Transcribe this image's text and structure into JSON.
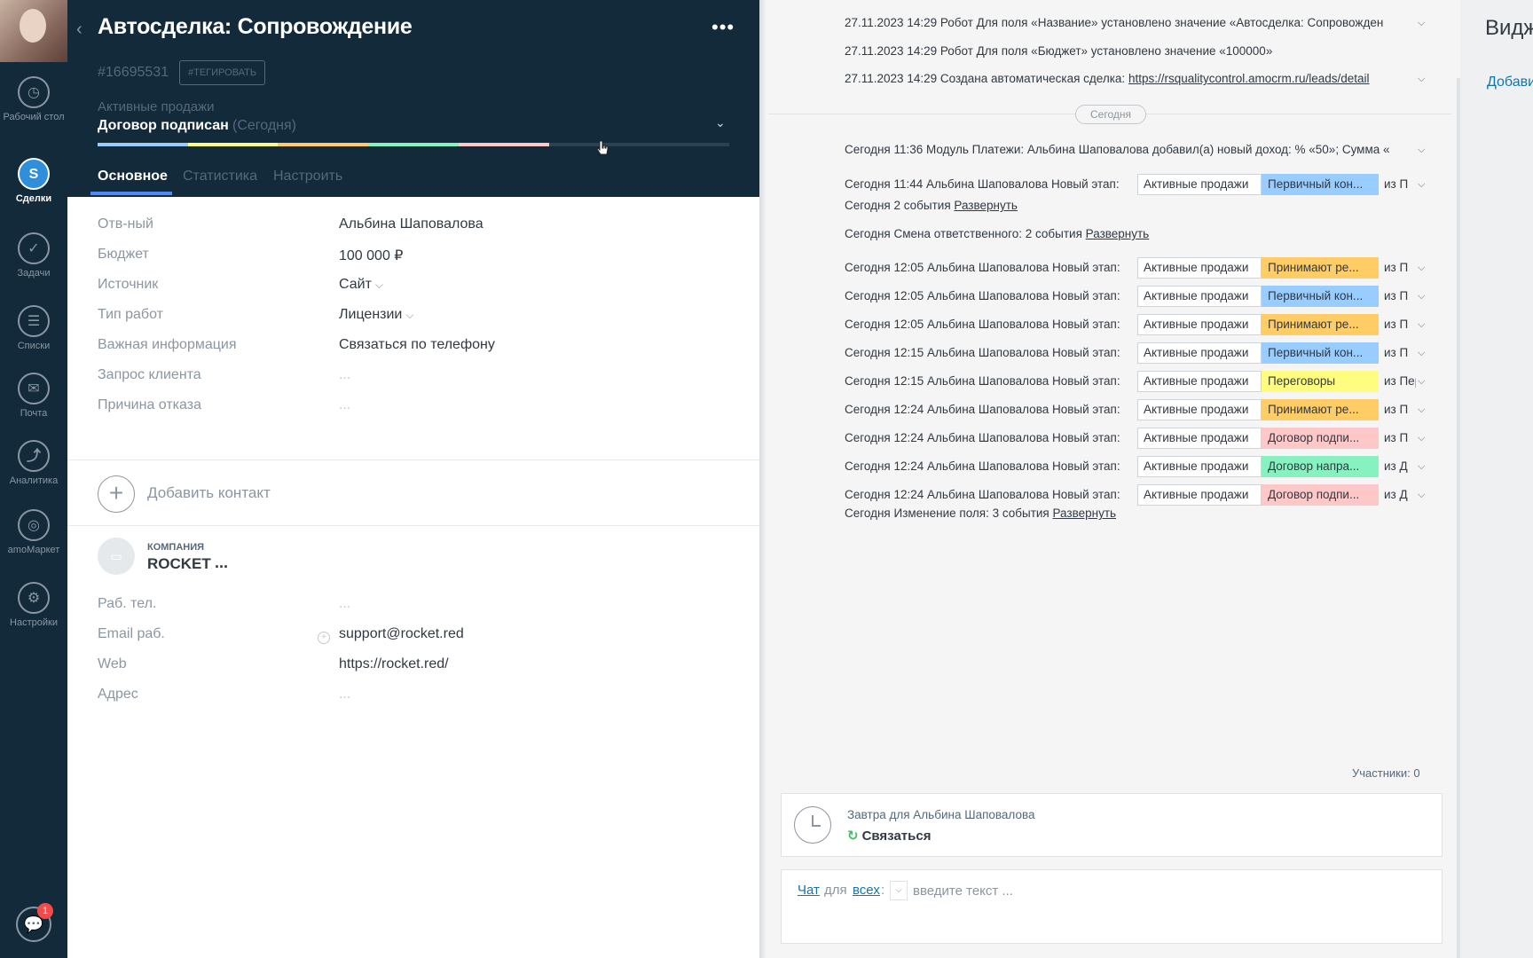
{
  "nav": {
    "items": [
      {
        "label": "Рабочий стол",
        "icon": "dashboard-icon"
      },
      {
        "label": "Сделки",
        "icon": "deals-icon"
      },
      {
        "label": "Задачи",
        "icon": "tasks-icon"
      },
      {
        "label": "Списки",
        "icon": "lists-icon"
      },
      {
        "label": "Почта",
        "icon": "mail-icon"
      },
      {
        "label": "Аналитика",
        "icon": "analytics-icon"
      },
      {
        "label": "amoМаркет",
        "icon": "market-icon"
      },
      {
        "label": "Настройки",
        "icon": "settings-icon"
      }
    ],
    "chat_badge": "1"
  },
  "card": {
    "title": "Автосделка: Сопровождение",
    "id": "#16695531",
    "tag_button": "#ТЕГИРОВАТЬ",
    "pipeline": "Активные продажи",
    "stage": "Договор подписан",
    "stage_when": "(Сегодня)",
    "progress_colors": [
      "#99ccfd",
      "#fffd7f",
      "#ffcc66",
      "#87f2c0",
      "#ffc8c8",
      "#2a4254",
      "#2a4254"
    ],
    "tabs": [
      "Основное",
      "Статистика",
      "Настроить"
    ],
    "fields": [
      {
        "label": "Отв-ный",
        "value": "Альбина Шаповалова"
      },
      {
        "label": "Бюджет",
        "value": "100 000 ₽"
      },
      {
        "label": "Источник",
        "value": "Сайт"
      },
      {
        "label": "Тип работ",
        "value": "Лицензии"
      },
      {
        "label": "Важная информация",
        "value": "Связаться по телефону"
      },
      {
        "label": "Запрос клиента",
        "value": "..."
      },
      {
        "label": "Причина отказа",
        "value": "..."
      }
    ],
    "add_contact": "Добавить контакт",
    "company": {
      "type_label": "КОМПАНИЯ",
      "name": "ROCKET",
      "more": "...",
      "fields": [
        {
          "label": "Раб. тел.",
          "value": "..."
        },
        {
          "label": "Email раб.",
          "value": "support@rocket.red"
        },
        {
          "label": "Web",
          "value": "https://rocket.red/"
        },
        {
          "label": "Адрес",
          "value": "..."
        }
      ]
    }
  },
  "feed": {
    "top_lines": [
      {
        "prefix": "27.11.2023 14:29 Робот Для поля «Название» установлено значение «Автосделка: Сопровожден",
        "link": ""
      },
      {
        "prefix": "27.11.2023 14:29 Робот Для поля «Бюджет» установлено значение «100000»",
        "link": ""
      },
      {
        "prefix": "27.11.2023 14:29 Создана автоматическая сделка: ",
        "link": "https://rsqualitycontrol.amocrm.ru/leads/detail"
      }
    ],
    "today_label": "Сегодня",
    "income_line": "Сегодня 11:36 Модуль Платежи: Альбина Шаповалова добавил(а) новый доход: % «50»; Сумма «",
    "stage_rows": [
      {
        "prefix": "Сегодня 11:44 Альбина Шаповалова Новый этап:",
        "old": "Активные продажи",
        "new": "Первичный кон...",
        "color": "#99ccff",
        "from": "из П"
      },
      {
        "prefix": "Сегодня 12:05 Альбина Шаповалова Новый этап:",
        "old": "Активные продажи",
        "new": "Принимают ре...",
        "color": "#ffcc66",
        "from": "из П"
      },
      {
        "prefix": "Сегодня 12:05 Альбина Шаповалова Новый этап:",
        "old": "Активные продажи",
        "new": "Первичный кон...",
        "color": "#99ccff",
        "from": "из П"
      },
      {
        "prefix": "Сегодня 12:05 Альбина Шаповалова Новый этап:",
        "old": "Активные продажи",
        "new": "Принимают ре...",
        "color": "#ffcc66",
        "from": "из П"
      },
      {
        "prefix": "Сегодня 12:15 Альбина Шаповалова Новый этап:",
        "old": "Активные продажи",
        "new": "Первичный кон...",
        "color": "#99ccff",
        "from": "из П"
      },
      {
        "prefix": "Сегодня 12:15 Альбина Шаповалова Новый этап:",
        "old": "Активные продажи",
        "new": "Переговоры",
        "color": "#fffd7f",
        "from": "из Первич"
      },
      {
        "prefix": "Сегодня 12:24 Альбина Шаповалова Новый этап:",
        "old": "Активные продажи",
        "new": "Принимают ре...",
        "color": "#ffcc66",
        "from": "из П"
      },
      {
        "prefix": "Сегодня 12:24 Альбина Шаповалова Новый этап:",
        "old": "Активные продажи",
        "new": "Договор подпи...",
        "color": "#ffc8c8",
        "from": "из П"
      },
      {
        "prefix": "Сегодня 12:24 Альбина Шаповалова Новый этап:",
        "old": "Активные продажи",
        "new": "Договор напра...",
        "color": "#87f2c0",
        "from": "из Д"
      },
      {
        "prefix": "Сегодня 12:24 Альбина Шаповалова Новый этап:",
        "old": "Активные продажи",
        "new": "Договор подпи...",
        "color": "#ffc8c8",
        "from": "из Д"
      }
    ],
    "events_2": {
      "text": "Сегодня 2 события ",
      "link": "Развернуть"
    },
    "resp_change": {
      "text": "Сегодня Смена ответственного: 2 события ",
      "link": "Развернуть"
    },
    "field_change": {
      "text": "Сегодня Изменение поля: 3 события ",
      "link": "Развернуть"
    },
    "participants": "Участники: 0",
    "task": {
      "when": "Завтра для Альбина Шаповалова",
      "action": "Связаться"
    },
    "chat": {
      "chat_link": "Чат",
      "for": "для",
      "all_link": "всех",
      "colon": ":",
      "placeholder": "введите текст ..."
    }
  },
  "widgets": {
    "title": "Виджеты",
    "add": "Добавить"
  }
}
